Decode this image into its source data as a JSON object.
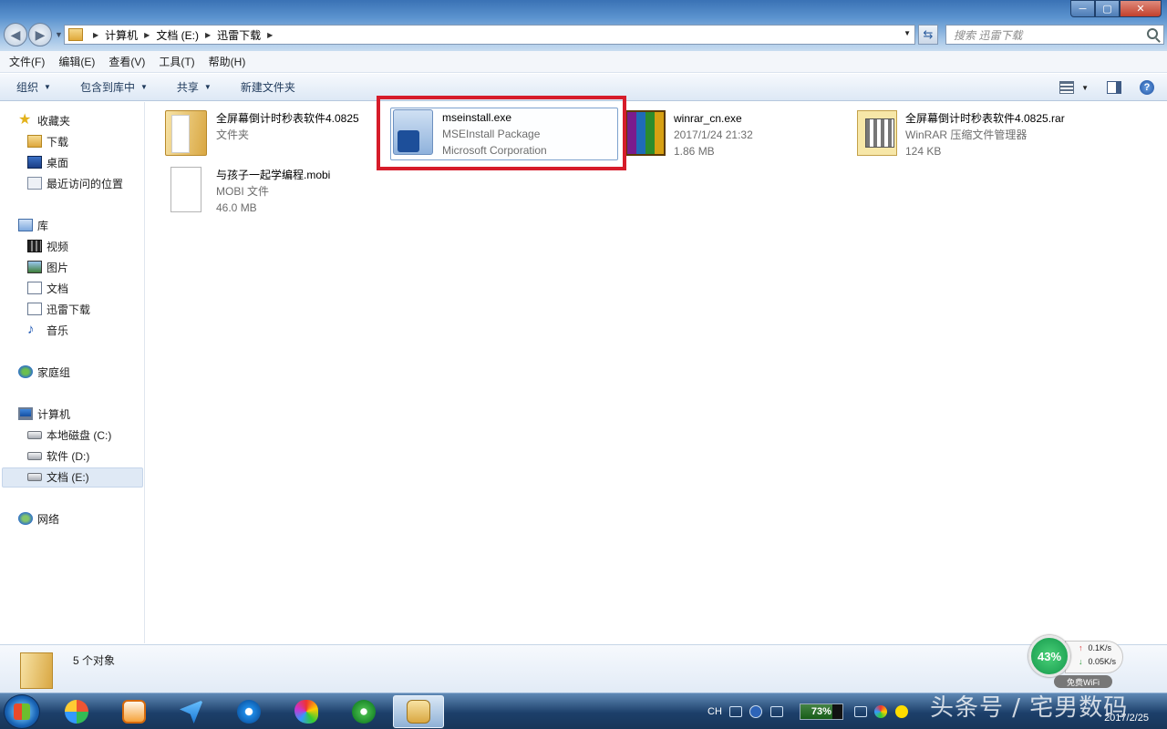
{
  "window": {
    "minimize": "─",
    "maximize": "▢",
    "close": "✕"
  },
  "address": {
    "crumbs": [
      "计算机",
      "文档 (E:)",
      "迅雷下载"
    ]
  },
  "search": {
    "placeholder": "搜索 迅雷下载"
  },
  "menu": [
    "文件(F)",
    "编辑(E)",
    "查看(V)",
    "工具(T)",
    "帮助(H)"
  ],
  "commands": {
    "organize": "组织",
    "include_library": "包含到库中",
    "share": "共享",
    "new_folder": "新建文件夹"
  },
  "sidebar": {
    "favorites": "收藏夹",
    "fav_items": [
      "下载",
      "桌面",
      "最近访问的位置"
    ],
    "libraries": "库",
    "lib_items": [
      "视频",
      "图片",
      "文档",
      "迅雷下载",
      "音乐"
    ],
    "homegroup": "家庭组",
    "computer": "计算机",
    "drives": [
      "本地磁盘 (C:)",
      "软件 (D:)",
      "文档 (E:)"
    ],
    "network": "网络"
  },
  "files": [
    {
      "name": "全屏幕倒计时秒表软件4.0825",
      "line2": "文件夹",
      "line3": ""
    },
    {
      "name": "mseinstall.exe",
      "line2": "MSEInstall Package",
      "line3": "Microsoft Corporation"
    },
    {
      "name": "winrar_cn.exe",
      "line2": "2017/1/24 21:32",
      "line3": "1.86 MB"
    },
    {
      "name": "全屏幕倒计时秒表软件4.0825.rar",
      "line2": "WinRAR 压缩文件管理器",
      "line3": "124 KB"
    },
    {
      "name": "与孩子一起学编程.mobi",
      "line2": "MOBI 文件",
      "line3": "46.0 MB"
    }
  ],
  "details": {
    "count": "5 个对象"
  },
  "netwidget": {
    "percent": "43%",
    "up": "0.1K/s",
    "down": "0.05K/s",
    "wifi": "免费WiFi"
  },
  "tray": {
    "lang": "CH",
    "battery": "73%",
    "watermark": "头条号 / 宅男数码",
    "date": "2017/2/25"
  },
  "colors": {
    "highlight_box": "#d61c2a",
    "selection": "#dfe9f5"
  }
}
